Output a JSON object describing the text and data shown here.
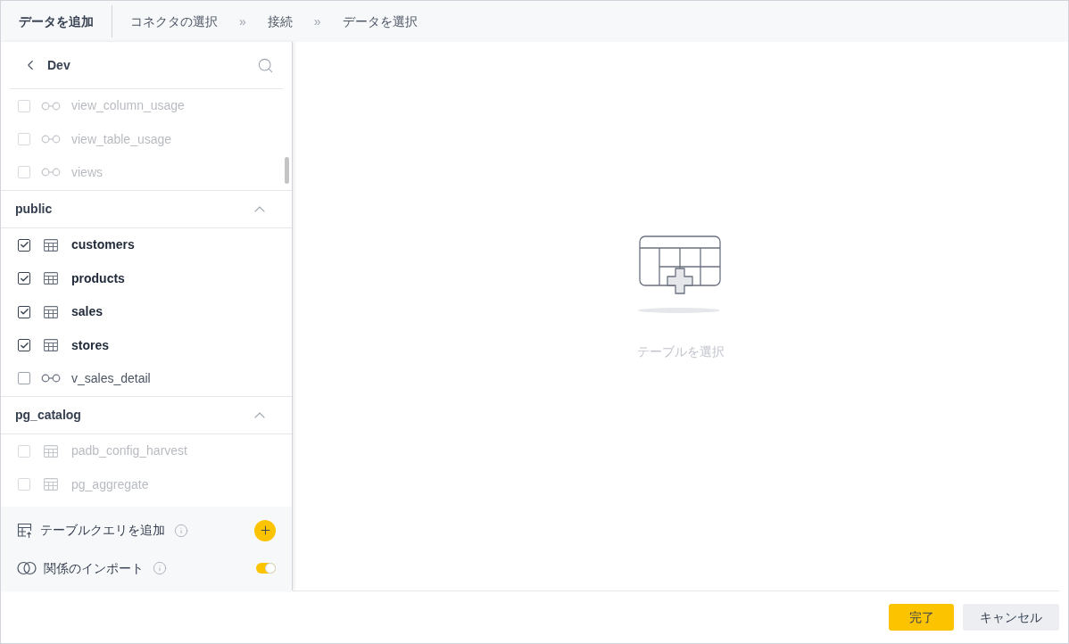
{
  "header": {
    "title": "データを追加",
    "steps": [
      {
        "label": "コネクタの選択"
      },
      {
        "label": "接続"
      },
      {
        "label": "データを選択"
      }
    ],
    "separator": "»"
  },
  "panel": {
    "back_label": "Dev",
    "leading_items": [
      {
        "name": "view_column_usage",
        "kind": "view",
        "checked": false,
        "disabled": true
      },
      {
        "name": "view_table_usage",
        "kind": "view",
        "checked": false,
        "disabled": true
      },
      {
        "name": "views",
        "kind": "view",
        "checked": false,
        "disabled": true
      }
    ],
    "schemas": [
      {
        "name": "public",
        "expanded": true,
        "items": [
          {
            "name": "customers",
            "kind": "table",
            "checked": true,
            "disabled": false
          },
          {
            "name": "products",
            "kind": "table",
            "checked": true,
            "disabled": false
          },
          {
            "name": "sales",
            "kind": "table",
            "checked": true,
            "disabled": false
          },
          {
            "name": "stores",
            "kind": "table",
            "checked": true,
            "disabled": false
          },
          {
            "name": "v_sales_detail",
            "kind": "view",
            "checked": false,
            "disabled": false
          }
        ]
      },
      {
        "name": "pg_catalog",
        "expanded": true,
        "items": [
          {
            "name": "padb_config_harvest",
            "kind": "table",
            "checked": false,
            "disabled": true
          },
          {
            "name": "pg_aggregate",
            "kind": "table",
            "checked": false,
            "disabled": true
          }
        ]
      }
    ],
    "add_query": {
      "label": "テーブルクエリを追加"
    },
    "import_relations": {
      "label": "関係のインポート",
      "on": true
    }
  },
  "empty_state": {
    "message": "テーブルを選択"
  },
  "buttons": [
    {
      "label": "完了",
      "kind": "primary"
    },
    {
      "label": "キャンセル",
      "kind": "secondary"
    }
  ]
}
